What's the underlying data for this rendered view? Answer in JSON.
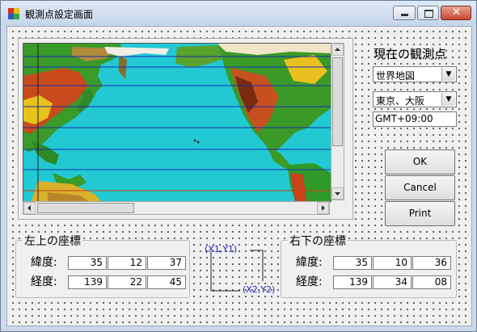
{
  "window": {
    "title": "観測点設定画面"
  },
  "current": {
    "heading": "現在の観測点",
    "map_select": "世界地図",
    "location_select": "東京、大阪",
    "timezone": "GMT+09:00"
  },
  "buttons": {
    "ok": "OK",
    "cancel": "Cancel",
    "print": "Print"
  },
  "top_left": {
    "title": "左上の座標",
    "lat_label": "緯度:",
    "lon_label": "経度:",
    "lat": [
      "35",
      "12",
      "37"
    ],
    "lon": [
      "139",
      "22",
      "45"
    ]
  },
  "bottom_right": {
    "title": "右下の座標",
    "lat_label": "緯度:",
    "lon_label": "経度:",
    "lat": [
      "35",
      "10",
      "36"
    ],
    "lon": [
      "139",
      "34",
      "08"
    ]
  },
  "diagram": {
    "p1": "(X1,Y1)",
    "p2": "(X2,Y2)"
  }
}
